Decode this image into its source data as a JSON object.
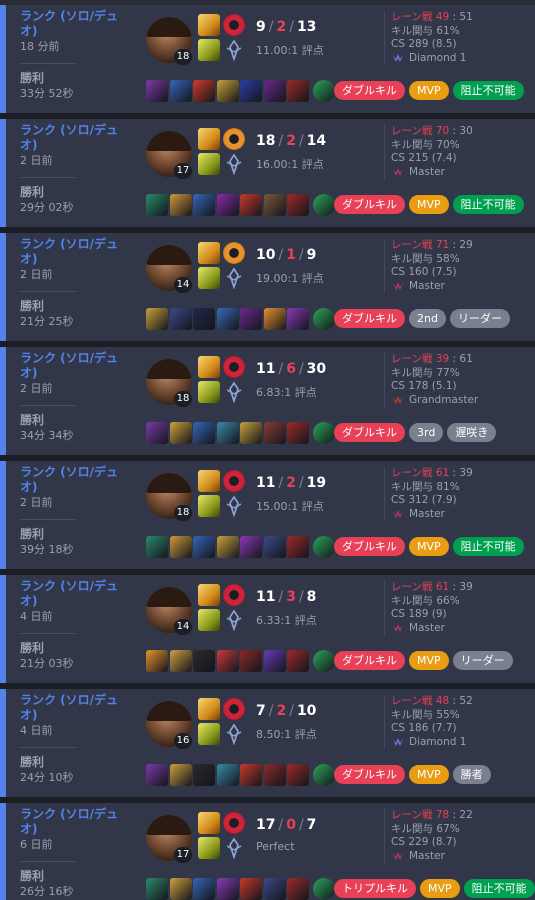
{
  "colors": {
    "win_accent": "#5383e8",
    "kill_red": "#e84057",
    "mvp_gold": "#e89d12",
    "green": "#00a050",
    "gray": "#7b8090"
  },
  "labels": {
    "lane_prefix": "レーン戦 ",
    "kp_prefix": "キル関与 ",
    "cs_prefix": "CS ",
    "ratio_suffix": " 評点"
  },
  "matches": [
    {
      "queue": "ランク (ソロ/デュオ)",
      "time_ago": "18 分前",
      "result": "勝利",
      "duration": "33分 52秒",
      "level": "18",
      "kills": "9",
      "deaths": "2",
      "assists": "13",
      "ratio": "11.00:1 評点",
      "lane_a": "49",
      "lane_b": "51",
      "kp": "61%",
      "cs": "289 (8.5)",
      "tier": "Diamond 1",
      "tier_color": "#8a6be0",
      "badges": [
        {
          "text": "ダブルキル",
          "kind": "red"
        },
        {
          "text": "MVP",
          "kind": "gold"
        },
        {
          "text": "阻止不可能",
          "kind": "green"
        }
      ],
      "items": [
        "#7b3aa8",
        "#3566b8",
        "#d23a2a",
        "#c8a23a",
        "#2c3fa8",
        "#6a2a8a",
        "#9c2a2a",
        "#2aa85a"
      ],
      "rune_color": "#d0233a"
    },
    {
      "queue": "ランク (ソロ/デュオ)",
      "time_ago": "2 日前",
      "result": "勝利",
      "duration": "29分 02秒",
      "level": "17",
      "kills": "18",
      "deaths": "2",
      "assists": "14",
      "ratio": "16.00:1 評点",
      "lane_a": "70",
      "lane_b": "30",
      "kp": "70%",
      "cs": "215 (7.4)",
      "tier": "Master",
      "tier_color": "#b0395e",
      "badges": [
        {
          "text": "ダブルキル",
          "kind": "red"
        },
        {
          "text": "MVP",
          "kind": "gold"
        },
        {
          "text": "阻止不可能",
          "kind": "green"
        }
      ],
      "items": [
        "#2a8a6a",
        "#d09a3a",
        "#3566b8",
        "#8a2aa8",
        "#c83a2a",
        "#7b5a3a",
        "#9c2a2a",
        "#2aa85a"
      ],
      "rune_color": "#e8922a"
    },
    {
      "queue": "ランク (ソロ/デュオ)",
      "time_ago": "2 日前",
      "result": "勝利",
      "duration": "21分 25秒",
      "level": "14",
      "kills": "10",
      "deaths": "1",
      "assists": "9",
      "ratio": "19.00:1 評点",
      "lane_a": "71",
      "lane_b": "29",
      "kp": "58%",
      "cs": "160 (7.5)",
      "tier": "Master",
      "tier_color": "#b0395e",
      "badges": [
        {
          "text": "ダブルキル",
          "kind": "red"
        },
        {
          "text": "2nd",
          "kind": "gray"
        },
        {
          "text": "リーダー",
          "kind": "gray"
        }
      ],
      "items": [
        "#c8a23a",
        "#3a4a8a",
        "#1f2a4a",
        "#3a6ab8",
        "#6a2a8a",
        "#e8922a",
        "#8a3ab8",
        "#2aa85a"
      ],
      "rune_color": "#e8922a"
    },
    {
      "queue": "ランク (ソロ/デュオ)",
      "time_ago": "2 日前",
      "result": "勝利",
      "duration": "34分 34秒",
      "level": "18",
      "kills": "11",
      "deaths": "6",
      "assists": "30",
      "ratio": "6.83:1 評点",
      "lane_a": "39",
      "lane_b": "61",
      "kp": "77%",
      "cs": "178 (5.1)",
      "tier": "Grandmaster",
      "tier_color": "#c0392b",
      "badges": [
        {
          "text": "ダブルキル",
          "kind": "red"
        },
        {
          "text": "3rd",
          "kind": "gray"
        },
        {
          "text": "遅咲き",
          "kind": "gray"
        }
      ],
      "items": [
        "#7b3aa8",
        "#d0a040",
        "#3566b8",
        "#3a8aa8",
        "#c8a23a",
        "#8a3a3a",
        "#9c2a2a",
        "#2aa85a"
      ],
      "rune_color": "#d0233a"
    },
    {
      "queue": "ランク (ソロ/デュオ)",
      "time_ago": "2 日前",
      "result": "勝利",
      "duration": "39分 18秒",
      "level": "18",
      "kills": "11",
      "deaths": "2",
      "assists": "19",
      "ratio": "15.00:1 評点",
      "lane_a": "61",
      "lane_b": "39",
      "kp": "81%",
      "cs": "312 (7.9)",
      "tier": "Master",
      "tier_color": "#b0395e",
      "badges": [
        {
          "text": "ダブルキル",
          "kind": "red"
        },
        {
          "text": "MVP",
          "kind": "gold"
        },
        {
          "text": "阻止不可能",
          "kind": "green"
        }
      ],
      "items": [
        "#2a8a6a",
        "#d09a3a",
        "#3566b8",
        "#c8a23a",
        "#8a3ab8",
        "#3a4a8a",
        "#9c2a2a",
        "#2aa85a"
      ],
      "rune_color": "#d0233a"
    },
    {
      "queue": "ランク (ソロ/デュオ)",
      "time_ago": "4 日前",
      "result": "勝利",
      "duration": "21分 03秒",
      "level": "14",
      "kills": "11",
      "deaths": "3",
      "assists": "8",
      "ratio": "6.33:1 評点",
      "lane_a": "61",
      "lane_b": "39",
      "kp": "66%",
      "cs": "189 (9)",
      "tier": "Master",
      "tier_color": "#b0395e",
      "badges": [
        {
          "text": "ダブルキル",
          "kind": "red"
        },
        {
          "text": "MVP",
          "kind": "gold"
        },
        {
          "text": "リーダー",
          "kind": "gray"
        }
      ],
      "items": [
        "#e8922a",
        "#d0a040",
        "#2a2a2a",
        "#c83a3a",
        "#8a2a2a",
        "#6a3ab8",
        "#9c2a2a",
        "#2aa85a"
      ],
      "rune_color": "#d0233a"
    },
    {
      "queue": "ランク (ソロ/デュオ)",
      "time_ago": "4 日前",
      "result": "勝利",
      "duration": "24分 10秒",
      "level": "16",
      "kills": "7",
      "deaths": "2",
      "assists": "10",
      "ratio": "8.50:1 評点",
      "lane_a": "48",
      "lane_b": "52",
      "kp": "55%",
      "cs": "186 (7.7)",
      "tier": "Diamond 1",
      "tier_color": "#8a6be0",
      "badges": [
        {
          "text": "ダブルキル",
          "kind": "red"
        },
        {
          "text": "MVP",
          "kind": "gold"
        },
        {
          "text": "勝者",
          "kind": "gray"
        }
      ],
      "items": [
        "#7b3aa8",
        "#d0a040",
        "#2a2a2a",
        "#3a8aa8",
        "#c83a2a",
        "#8a2a2a",
        "#9c2a2a",
        "#2aa85a"
      ],
      "rune_color": "#d0233a"
    },
    {
      "queue": "ランク (ソロ/デュオ)",
      "time_ago": "6 日前",
      "result": "勝利",
      "duration": "26分 16秒",
      "level": "17",
      "kills": "17",
      "deaths": "0",
      "assists": "7",
      "ratio": "Perfect",
      "lane_a": "78",
      "lane_b": "22",
      "kp": "67%",
      "cs": "229 (8.7)",
      "tier": "Master",
      "tier_color": "#b0395e",
      "badges": [
        {
          "text": "トリプルキル",
          "kind": "red"
        },
        {
          "text": "MVP",
          "kind": "gold"
        },
        {
          "text": "阻止不可能",
          "kind": "green"
        }
      ],
      "items": [
        "#2a8a6a",
        "#d0a040",
        "#3566b8",
        "#8a3ab8",
        "#c83a2a",
        "#3a4a8a",
        "#9c2a2a",
        "#2aa85a"
      ],
      "rune_color": "#d0233a"
    }
  ]
}
